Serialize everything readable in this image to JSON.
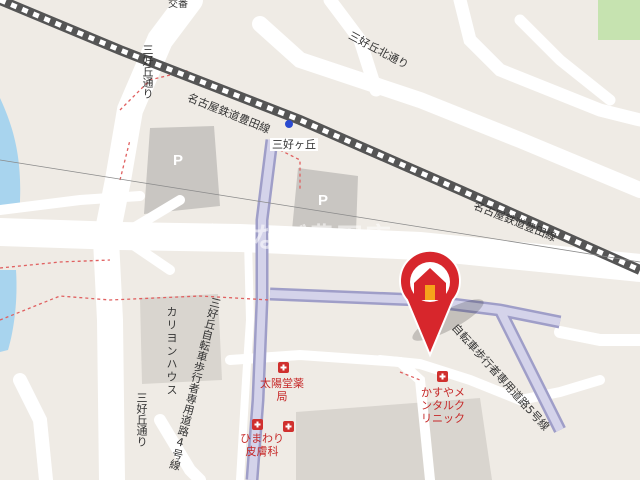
{
  "map": {
    "labels": {
      "koban": "交番",
      "miyoshigaoka_kita_dori": "三好丘北通り",
      "miyoshigaoka_dori_top": "三好丘通り",
      "meitetsu_toyota_line_top": "名古屋鉄道豊田線",
      "station_name": "三好ヶ丘",
      "meitetsu_toyota_line_right": "名古屋鉄道豊田線",
      "parking_symbol": "P",
      "carioka_building": "カリヨンハウス",
      "bike_path_4": "三好丘自転車歩行者専用道路4号線",
      "miyoshigaoka_dori_bottom": "三好丘通り",
      "taiyodo_pharmacy": "太陽堂薬局",
      "himawari_dermatology": "ひまわり皮膚科",
      "kasuya_mental_clinic": "かすやメンタルクリニック",
      "bike_path_5": "自転車歩行者専用道路5号線",
      "watermark": "住まなび豊田店"
    },
    "icons": {
      "property_marker": "house-pin-icon",
      "hospital": "hospital-cross-icon",
      "station": "station-icon"
    },
    "colors": {
      "background": "#efebe5",
      "road": "#ffffff",
      "building": "#d9d5cf",
      "parking": "#c9c6c2",
      "railway": "#777777",
      "bike_path": "#b9b8d8",
      "water": "#a8d4ee",
      "park": "#c6e3b0",
      "boundary": "#e06060",
      "marker_red": "#d7262c",
      "hospital_red": "#d0302e"
    }
  }
}
